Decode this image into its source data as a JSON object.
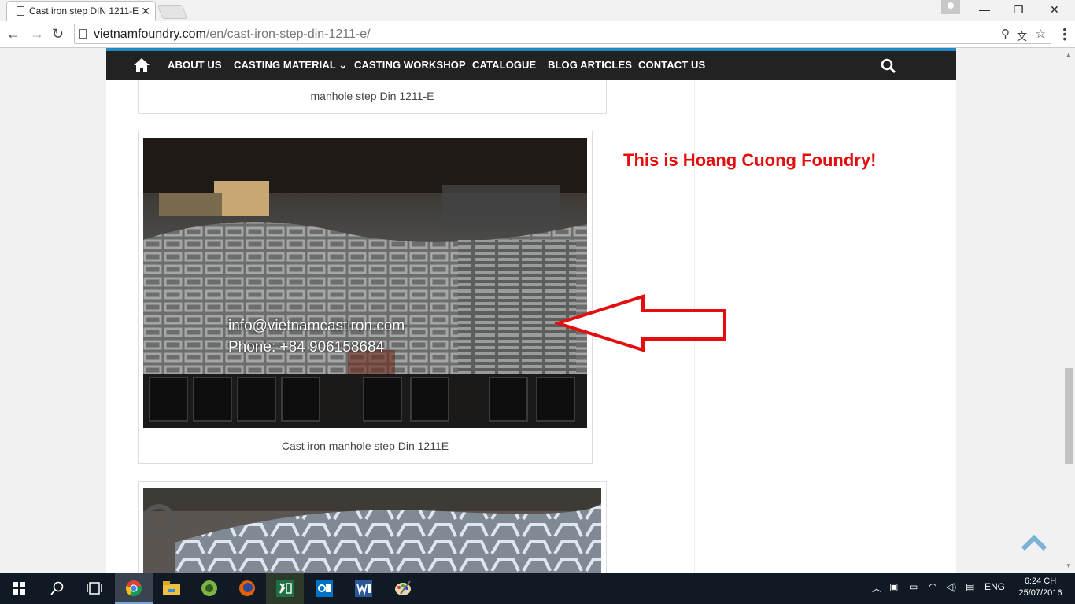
{
  "browser": {
    "tab_title": "Cast iron step DIN 1211-E",
    "tab_close": "✕",
    "url_host": "vietnamfoundry.com",
    "url_path": "/en/cast-iron-step-din-1211-e/",
    "window_minimize": "—",
    "window_restore": "❐",
    "window_close": "✕"
  },
  "nav": {
    "items": [
      "ABOUT US",
      "CASTING MATERIAL",
      "CASTING WORKSHOP",
      "CATALOGUE",
      "BLOG ARTICLES",
      "CONTACT US"
    ],
    "dropdown_marker": "⌄"
  },
  "figures": {
    "top_caption": "manhole step Din 1211-E",
    "main_caption": "Cast iron manhole step Din 1211E",
    "watermark_email": "info@vietnamcastiron.com",
    "watermark_phone": "Phone: +84 906158684"
  },
  "promo_text": "This is Hoang Cuong Foundry!",
  "taskbar": {
    "language": "ENG",
    "time": "6:24 CH",
    "date": "25/07/2016"
  },
  "colors": {
    "accent": "#1e8bc3",
    "promo": "#e30f0f",
    "navbar": "#222222"
  }
}
